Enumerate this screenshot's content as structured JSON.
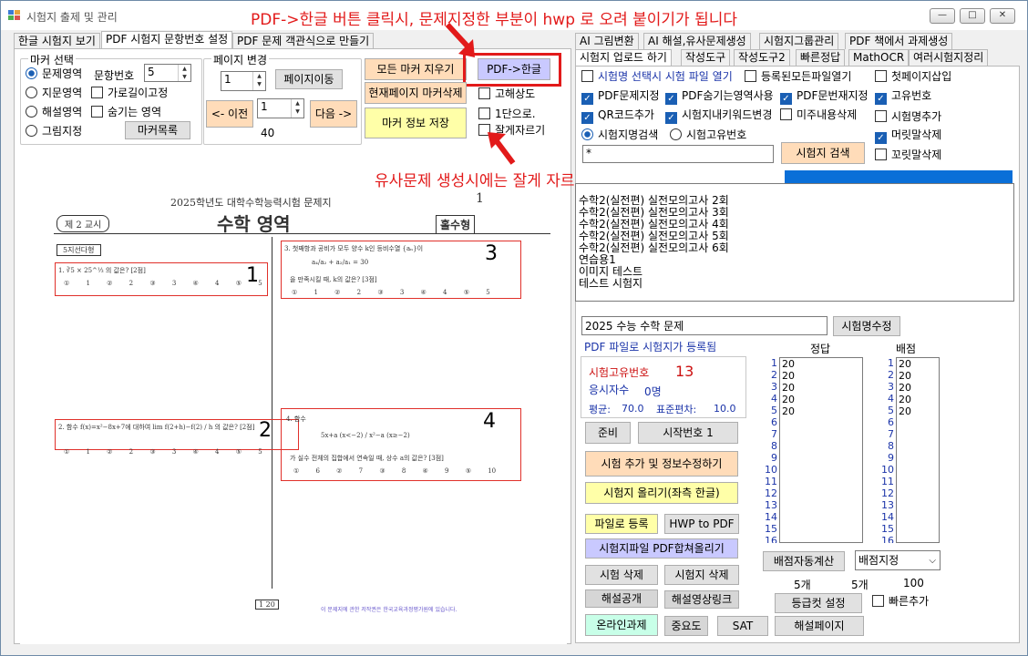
{
  "window": {
    "title": "시험지 출제 및 관리",
    "controls": [
      "—",
      "□",
      "✕"
    ]
  },
  "left_tabs": [
    "한글 시험지 보기",
    "PDF 시험지 문항번호 설정",
    "PDF 문제 객관식으로 만들기"
  ],
  "right_tabs_row1": [
    "AI 그림변환",
    "AI 해설,유사문제생성",
    "시험지그룹관리",
    "PDF 책에서 과제생성"
  ],
  "right_tabs_row2": [
    "시험지 업로드 하기",
    "작성도구",
    "작성도구2",
    "빠른정답",
    "MathOCR",
    "여러시험지정리"
  ],
  "marker_group": {
    "title": "마커 선택",
    "radios": [
      "문제영역",
      "지문영역",
      "해설영역",
      "그림지정"
    ],
    "question_no_label": "문항번호",
    "question_no_value": "5",
    "horizontal_fixed": "가로길이고정",
    "hidden_area": "숨기는 영역",
    "marker_list_btn": "마커목록"
  },
  "page_group": {
    "title": "페이지 변경",
    "page_value": "1",
    "move_btn": "페이지이동",
    "prev_btn": "<- 이전",
    "cur_value": "1",
    "next_btn": "다음 ->",
    "total": "40"
  },
  "buttons": {
    "clear_markers": "모든 마커 지우기",
    "pdf_to_hangul": "PDF->한글",
    "delete_page_markers": "현재페이지 마커삭제",
    "save_marker_info": "마커 정보 저장"
  },
  "checks_mid": [
    "고해상도",
    "1단으로.",
    "잘게자르기"
  ],
  "annotations": {
    "top": "PDF->한글 버튼 클릭시, 문제지정한 부분이 hwp 로 오려 붙이기가 됩니다",
    "mid": "유사문제 생성시에는 잘게 자르기에 체크하지 마세요"
  },
  "paper": {
    "header": "2025학년도 대학수학능력시험 문제지",
    "page_no": "1",
    "session": "제 2 교시",
    "subject": "수학 영역",
    "type": "홀수형",
    "section": "5지선다형",
    "boxes": [
      "1",
      "2",
      "3",
      "4"
    ],
    "q1": "1.  ∛5 × 25^⅓ 의 값은? [2점]",
    "q2": "2.  함수 f(x)=x²−8x+7에 대하여 lim f(2+h)−f(2) / h 의 값은? [2점]",
    "q3": "3.  첫째항과 공비가 모두 양수 k인 등비수열 {aₙ}이",
    "q3b": "a₄/a₂ + a₂/a₁ = 30",
    "q3c": "을 만족시킬 때, k의 값은? [3점]",
    "q4": "4.  함수",
    "q4b": "5x+a (x<−2) / x²−a (x≥−2)",
    "q4c": "가 실수 전체의 집합에서 연속일 때, 상수 a의 값은? [3점]",
    "opts12": "① 1 ② 2 ③ 3 ④ 4 ⑤ 5",
    "opts4": "① 6 ② 7 ③ 8 ④ 9 ⑤ 10",
    "footer_page": "1 20",
    "footer_note": "이 문제지에 관한 저작권은 한국교육과정평가원에 있습니다."
  },
  "upload": {
    "checks": [
      {
        "label": "시험명 선택시 시험 파일 열기",
        "on": false
      },
      {
        "label": "등록된모든파일열기",
        "on": false
      },
      {
        "label": "첫페이지삽입",
        "on": false
      },
      {
        "label": "PDF문제지정",
        "on": true
      },
      {
        "label": "PDF숨기는영역사용",
        "on": true
      },
      {
        "label": "PDF문번재지정",
        "on": true
      },
      {
        "label": "고유번호",
        "on": true
      },
      {
        "label": "QR코드추가",
        "on": true
      },
      {
        "label": "시험지내키워드변경",
        "on": true
      },
      {
        "label": "미주내용삭제",
        "on": false
      },
      {
        "label": "시험명추가",
        "on": false
      },
      {
        "label": "머릿말삭제",
        "on": true
      },
      {
        "label": "꼬릿말삭제",
        "on": false
      }
    ],
    "radio_name": "시험지명검색",
    "radio_id": "시험고유번호",
    "search_value": "*",
    "search_btn": "시험지 검색",
    "exam_list": [
      "수학2(실전편) 실전모의고사 2회",
      "수학2(실전편) 실전모의고사 3회",
      "수학2(실전편) 실전모의고사 4회",
      "수학2(실전편) 실전모의고사 5회",
      "수학2(실전편) 실전모의고사 6회",
      "연습용1",
      "이미지 테스트",
      "테스트 시험지"
    ],
    "exam_name": "2025 수능 수학 문제",
    "rename_btn": "시험명수정",
    "registered": "PDF 파일로 시험지가 등록됨",
    "answer_header": "정답",
    "score_header": "배점",
    "uid_label": "시험고유번호",
    "uid_value": "13",
    "takers_label": "응시자수",
    "takers_value": "0명",
    "avg_label": "평균:",
    "avg_value": "70.0",
    "std_label": "표준편차:",
    "std_value": "10.0",
    "row_nums": [
      "1",
      "2",
      "3",
      "4",
      "5",
      "6",
      "7",
      "8",
      "9",
      "10",
      "11",
      "12",
      "13",
      "14",
      "15",
      "16"
    ],
    "answers": [
      "20",
      "20",
      "20",
      "20",
      "20"
    ],
    "scores": [
      "20",
      "20",
      "20",
      "20",
      "20"
    ],
    "prep_btn": "준비",
    "start_no_btn": "시작번호 1",
    "add_btn": "시험 추가 및 정보수정하기",
    "upload_btn": "시험지 올리기(좌측 한글)",
    "file_reg_btn": "파일로 등록",
    "hwp_pdf_btn": "HWP to PDF",
    "merge_btn": "시험지파일 PDF합쳐올리기",
    "del_exam_btn": "시험 삭제",
    "del_paper_btn": "시험지 삭제",
    "open_sol_btn": "해설공개",
    "video_btn": "해설영상링크",
    "online_btn": "온라인과제",
    "importance_btn": "중요도",
    "sat_btn": "SAT",
    "sol_page_btn": "해설페이지",
    "auto_score_btn": "배점자동계산",
    "score_select": "배점지정",
    "count1": "5개",
    "count2": "5개",
    "total_score": "100",
    "grade_btn": "등급컷 설정",
    "quick_add": "빠른추가"
  },
  "colors": {
    "accent": "#1a5fb4",
    "annot": "#e21a1a",
    "peach": "#ffdcb9",
    "yellow": "#ffffa8",
    "lavender": "#c9c9ff",
    "progress": "#0a6fd8"
  }
}
